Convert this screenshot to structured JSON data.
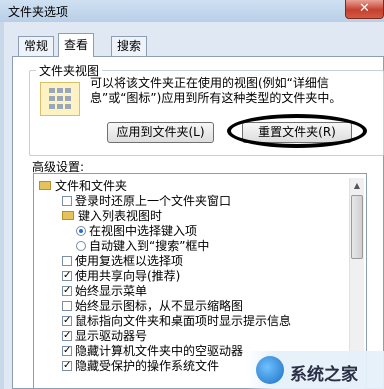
{
  "window": {
    "title": "文件夹选项",
    "close_label": "✕"
  },
  "tabs": [
    {
      "label": "常规"
    },
    {
      "label": "查看",
      "active": true
    },
    {
      "label": "搜索"
    }
  ],
  "folder_views": {
    "group_label": "文件夹视图",
    "description": "可以将该文件夹正在使用的视图(例如“详细信息”或“图标”)应用到所有这种类型的文件夹中。",
    "apply_button": "应用到文件夹(L)",
    "reset_button": "重置文件夹(R)"
  },
  "advanced": {
    "label": "高级设置:",
    "items": [
      {
        "kind": "folder",
        "label": "文件和文件夹"
      },
      {
        "kind": "checkbox",
        "checked": false,
        "label": "登录时还原上一个文件夹窗口"
      },
      {
        "kind": "folder",
        "label": "键入列表视图时"
      },
      {
        "kind": "radio",
        "checked": true,
        "label": "在视图中选择键入项"
      },
      {
        "kind": "radio",
        "checked": false,
        "label": "自动键入到“搜索”框中"
      },
      {
        "kind": "checkbox",
        "checked": false,
        "label": "使用复选框以选择项"
      },
      {
        "kind": "checkbox",
        "checked": true,
        "label": "使用共享向导(推荐)"
      },
      {
        "kind": "checkbox",
        "checked": true,
        "label": "始终显示菜单"
      },
      {
        "kind": "checkbox",
        "checked": false,
        "label": "始终显示图标，从不显示缩略图"
      },
      {
        "kind": "checkbox",
        "checked": true,
        "label": "鼠标指向文件夹和桌面项时显示提示信息"
      },
      {
        "kind": "checkbox",
        "checked": true,
        "label": "显示驱动器号"
      },
      {
        "kind": "checkbox",
        "checked": true,
        "label": "隐藏计算机文件夹中的空驱动器"
      },
      {
        "kind": "checkbox",
        "checked": true,
        "label": "隐藏受保护的操作系统文件"
      }
    ]
  },
  "watermark": {
    "text": "系统之家"
  }
}
